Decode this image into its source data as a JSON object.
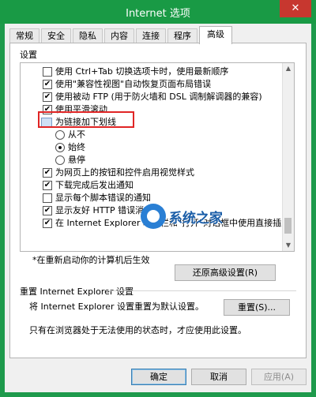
{
  "window": {
    "title": "Internet 选项",
    "close_glyph": "✕"
  },
  "tabs": [
    {
      "label": "常规"
    },
    {
      "label": "安全"
    },
    {
      "label": "隐私"
    },
    {
      "label": "内容"
    },
    {
      "label": "连接"
    },
    {
      "label": "程序"
    },
    {
      "label": "高级",
      "active": true
    }
  ],
  "settings_label": "设置",
  "settings_list": {
    "item0": "使用 Ctrl+Tab 切换选项卡时，使用最新顺序",
    "item1": "使用\"兼容性视图\"自动恢复页面布局错误",
    "item2": "使用被动 FTP (用于防火墙和 DSL 调制解调器的兼容)",
    "item3": "使用平滑滚动",
    "item4": "为链接加下划线",
    "item5": "从不",
    "item6": "始终",
    "item7": "悬停",
    "item8": "为网页上的按钮和控件启用视觉样式",
    "item9": "下载完成后发出通知",
    "item10": "显示每个脚本错误的通知",
    "item11": "显示友好 HTTP 错误消息",
    "item12": "在 Internet Explorer 地址栏和\"打开\"对话框中使用直接插入自",
    "checked": [
      false,
      true,
      true,
      true,
      null,
      false,
      true,
      false,
      true,
      true,
      false,
      true,
      true
    ]
  },
  "scrollbar": {
    "up_glyph": "▲",
    "down_glyph": "▼"
  },
  "watermark": {
    "text": "系统之家"
  },
  "restart_note": "*在重新启动你的计算机后生效",
  "restore_button": "还原高级设置(R)",
  "reset_section": {
    "title": "重置 Internet Explorer 设置",
    "description": "将 Internet Explorer 设置重置为默认设置。",
    "button": "重置(S)...",
    "note": "只有在浏览器处于无法使用的状态时，才应使用此设置。"
  },
  "buttons": {
    "ok": "确定",
    "cancel": "取消",
    "apply": "应用(A)"
  },
  "colors": {
    "titlebar": "#199a45",
    "close": "#c7372f",
    "highlight": "#e02525"
  }
}
